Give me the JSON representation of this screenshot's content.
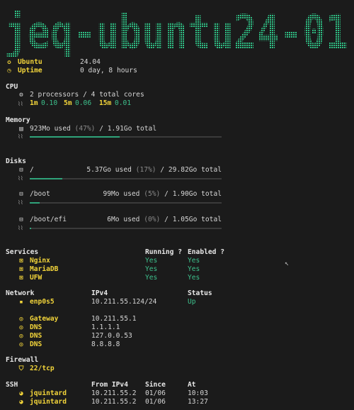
{
  "hostname": "jeq-ubuntu24-01",
  "colors": {
    "accent": "#f2d43a",
    "good": "#3dc08c",
    "bar": "#2fa37a",
    "bg": "#1b1b1b"
  },
  "system": [
    {
      "icon": "ubuntu-icon",
      "label": "Ubuntu",
      "value": "24.04"
    },
    {
      "icon": "clock-icon",
      "label": "Uptime",
      "value": "0 day, 8 hours"
    }
  ],
  "cpu": {
    "heading": "CPU",
    "summary": "2 processors / 4 total cores",
    "load": [
      {
        "label": "1m",
        "value": "0.10"
      },
      {
        "label": "5m",
        "value": "0.06"
      },
      {
        "label": "15m",
        "value": "0.01"
      }
    ]
  },
  "memory": {
    "heading": "Memory",
    "used": "923Mo used",
    "pct": "(47%)",
    "sep": "/",
    "total": "1.91Go total",
    "fraction": 0.47
  },
  "disks": {
    "heading": "Disks",
    "items": [
      {
        "mount": "/",
        "used": "5.37Go used",
        "pct": "(17%)",
        "sep": "/",
        "total": "29.82Go total",
        "fraction": 0.17
      },
      {
        "mount": "/boot",
        "used": "99Mo used",
        "pct": "(5%)",
        "sep": "/",
        "total": "1.90Go total",
        "fraction": 0.05
      },
      {
        "mount": "/boot/efi",
        "used": "6Mo used",
        "pct": "(0%)",
        "sep": "/",
        "total": "1.05Go total",
        "fraction": 0.0
      }
    ]
  },
  "services": {
    "heading": "Services",
    "col_running": "Running ?",
    "col_enabled": "Enabled ?",
    "items": [
      {
        "name": "Nginx",
        "running": "Yes",
        "enabled": "Yes"
      },
      {
        "name": "MariaDB",
        "running": "Yes",
        "enabled": "Yes"
      },
      {
        "name": "UFW",
        "running": "Yes",
        "enabled": "Yes"
      }
    ]
  },
  "network": {
    "heading": "Network",
    "col_ipv4": "IPv4",
    "col_status": "Status",
    "interfaces": [
      {
        "name": "enp0s5",
        "ip": "10.211.55.124/24",
        "status": "Up"
      }
    ],
    "resolvers": [
      {
        "label": "Gateway",
        "ip": "10.211.55.1"
      },
      {
        "label": "DNS",
        "ip": "1.1.1.1"
      },
      {
        "label": "DNS",
        "ip": "127.0.0.53"
      },
      {
        "label": "DNS",
        "ip": "8.8.8.8"
      }
    ]
  },
  "firewall": {
    "heading": "Firewall",
    "rules": [
      "22/tcp"
    ]
  },
  "ssh": {
    "heading": "SSH",
    "col_from": "From IPv4",
    "col_since": "Since",
    "col_at": "At",
    "sessions": [
      {
        "user": "jquintard",
        "from": "10.211.55.2",
        "since": "01/06",
        "at": "10:03"
      },
      {
        "user": "jquintard",
        "from": "10.211.55.2",
        "since": "01/06",
        "at": "13:27"
      }
    ]
  }
}
